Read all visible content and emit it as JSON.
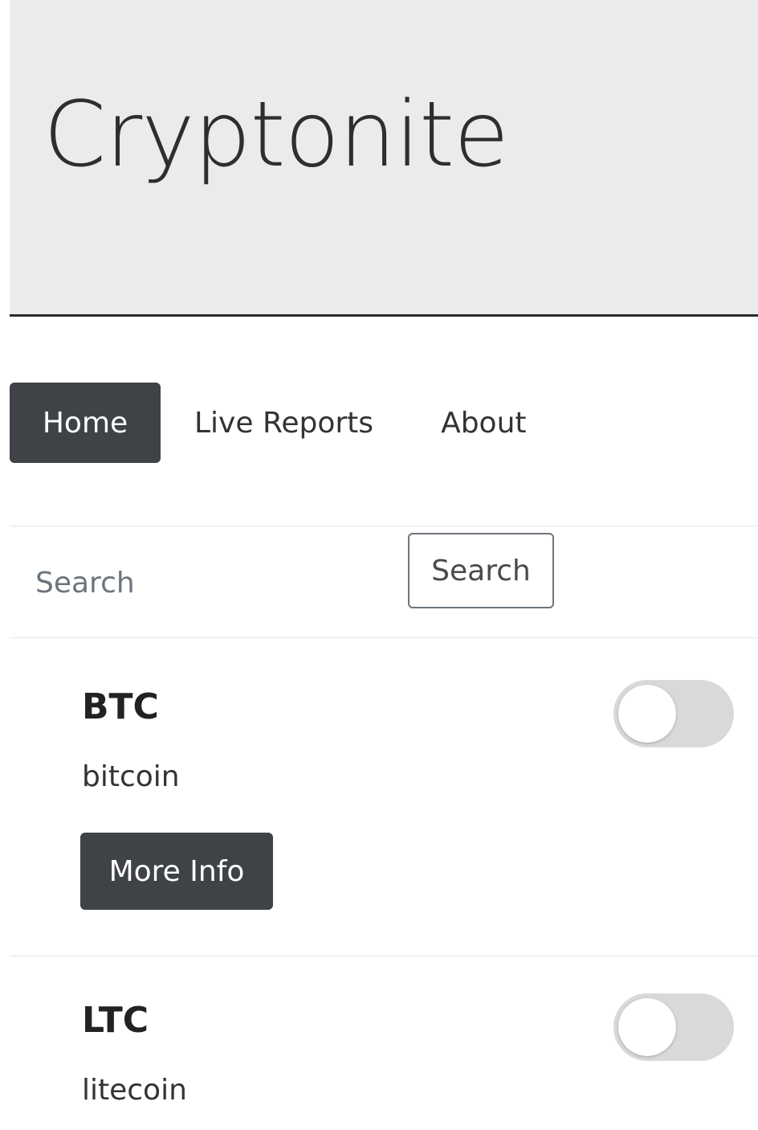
{
  "header": {
    "brand": "Cryptonite"
  },
  "nav": {
    "items": [
      {
        "label": "Home",
        "active": true
      },
      {
        "label": "Live Reports",
        "active": false
      },
      {
        "label": "About",
        "active": false
      }
    ]
  },
  "search": {
    "placeholder": "Search",
    "value": "",
    "button_label": "Search"
  },
  "coins": [
    {
      "symbol": "BTC",
      "name": "bitcoin",
      "button_label": "More Info",
      "toggled": false
    },
    {
      "symbol": "LTC",
      "name": "litecoin",
      "toggled": false
    }
  ],
  "colors": {
    "header_bg": "#ebebeb",
    "active_nav": "#3f4247",
    "button_dark": "#3f4247",
    "toggle_off": "#d9d9d9"
  }
}
